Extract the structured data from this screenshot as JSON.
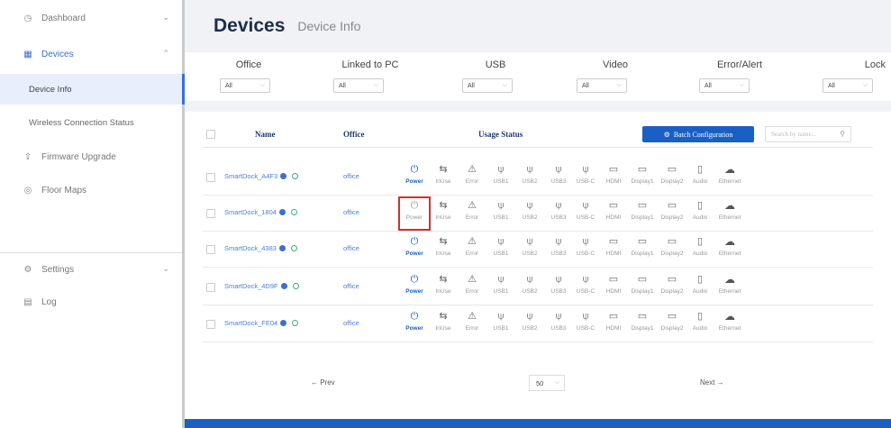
{
  "sidebar": {
    "items": [
      {
        "label": "Dashboard",
        "icon": "clock-icon"
      },
      {
        "label": "Devices",
        "icon": "grid-icon"
      },
      {
        "label": "Firmware Upgrade",
        "icon": "upload-icon"
      },
      {
        "label": "Floor Maps",
        "icon": "location-icon"
      },
      {
        "label": "Settings",
        "icon": "gear-icon"
      },
      {
        "label": "Log",
        "icon": "log-icon"
      }
    ],
    "sub_items": [
      "Device Info",
      "Wireless Connection Status"
    ]
  },
  "header": {
    "title": "Devices",
    "subtitle": "Device Info"
  },
  "filters": [
    {
      "label": "Office",
      "value": "All"
    },
    {
      "label": "Linked to PC",
      "value": "All"
    },
    {
      "label": "USB",
      "value": "All"
    },
    {
      "label": "Video",
      "value": "All"
    },
    {
      "label": "Error/Alert",
      "value": "All"
    },
    {
      "label": "Lock",
      "value": "All"
    }
  ],
  "table": {
    "headers": {
      "name": "Name",
      "office": "Office",
      "usage": "Usage Status"
    },
    "batch_label": "Batch Configuration",
    "search_placeholder": "Search by name...",
    "status_labels": [
      "Power",
      "InUse",
      "Error",
      "USB1",
      "USB2",
      "USB3",
      "USB-C",
      "HDMI",
      "Display1",
      "Display2",
      "Audio",
      "Ethernet"
    ],
    "rows": [
      {
        "name": "SmartDock_A4F3",
        "office": "office",
        "power_on": true
      },
      {
        "name": "SmartDock_1804",
        "office": "office",
        "power_on": false
      },
      {
        "name": "SmartDock_4383",
        "office": "office",
        "power_on": true
      },
      {
        "name": "SmartDock_4D9F",
        "office": "office",
        "power_on": true
      },
      {
        "name": "SmartDock_FE04",
        "office": "office",
        "power_on": true
      }
    ]
  },
  "pagination": {
    "prev": "← Prev",
    "next": "Next →",
    "page_size": "50"
  },
  "colors": {
    "accent": "#1a5fc4",
    "highlight": "#c8352d"
  }
}
